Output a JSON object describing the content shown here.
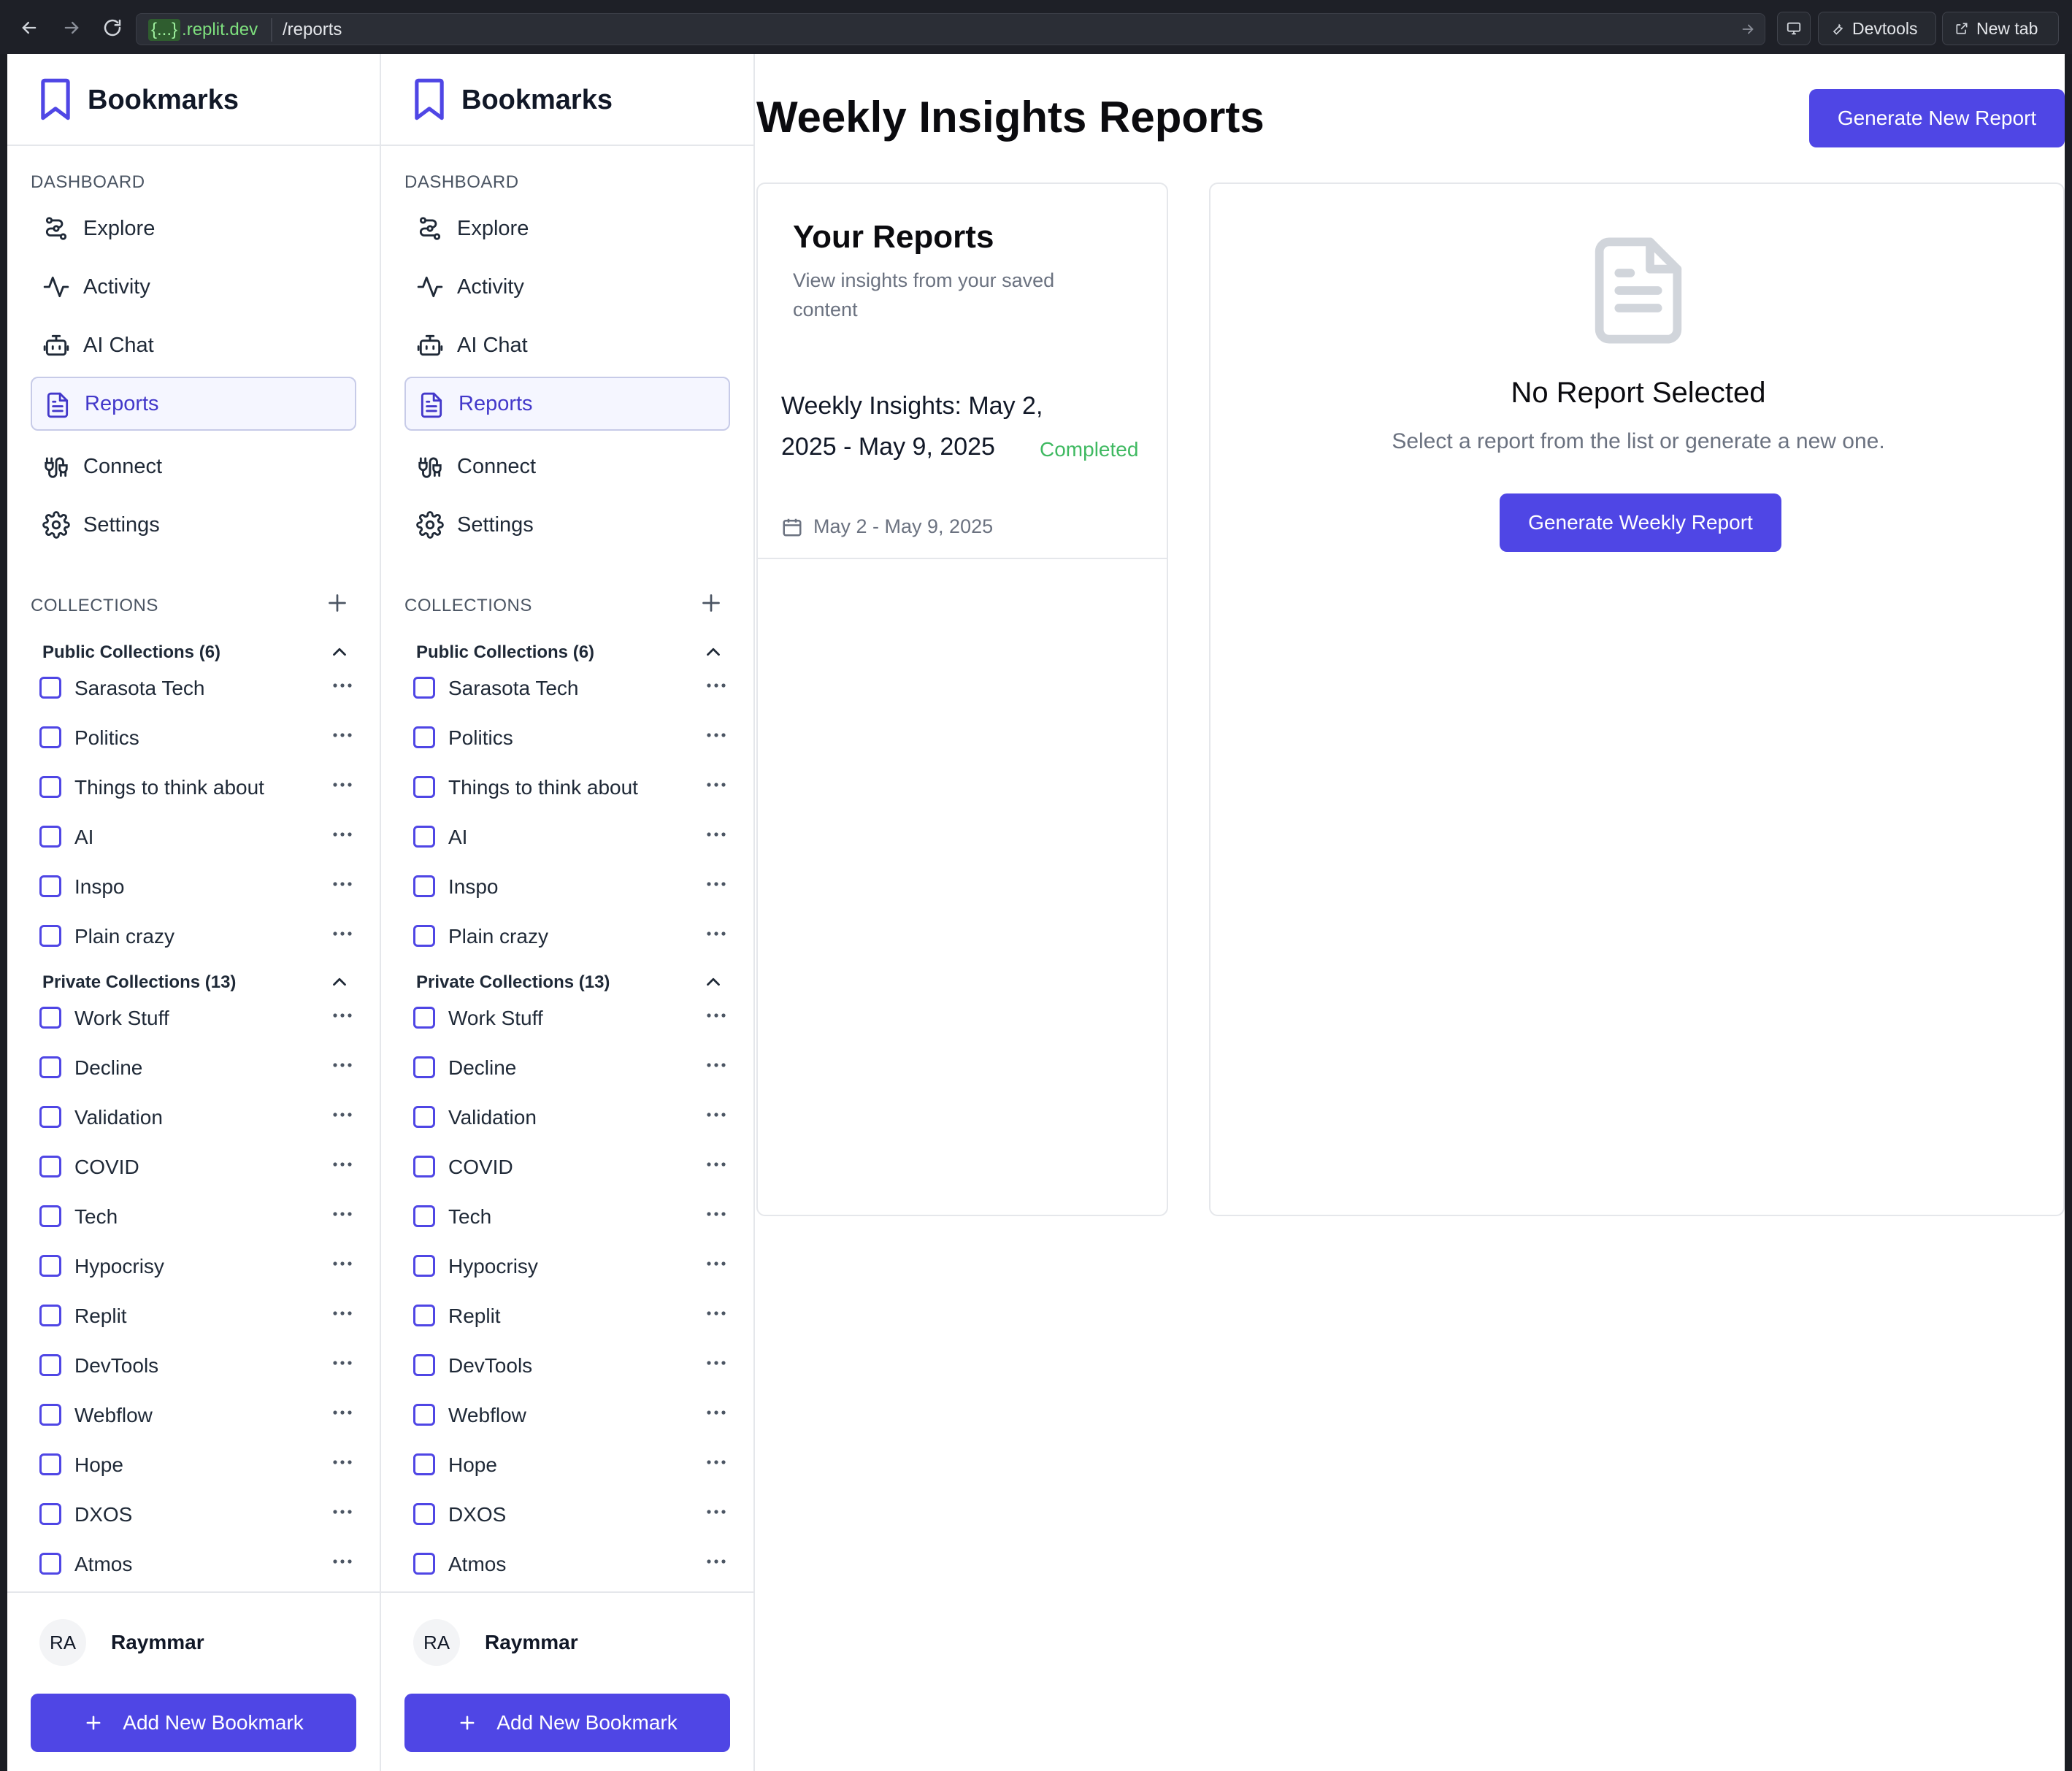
{
  "browser": {
    "url_host_braces": "{...}",
    "url_host": ".replit.dev",
    "url_path": "/reports",
    "devtools_label": "Devtools",
    "new_tab_label": "New tab"
  },
  "sidebar": {
    "title": "Bookmarks",
    "dashboard_label": "DASHBOARD",
    "nav": [
      {
        "label": "Explore",
        "icon": "explore-icon"
      },
      {
        "label": "Activity",
        "icon": "activity-icon"
      },
      {
        "label": "AI Chat",
        "icon": "bot-icon"
      },
      {
        "label": "Reports",
        "icon": "document-icon",
        "active": true
      },
      {
        "label": "Connect",
        "icon": "cable-icon"
      },
      {
        "label": "Settings",
        "icon": "gear-icon"
      }
    ],
    "collections_label": "COLLECTIONS",
    "public_group": "Public Collections (6)",
    "public_items": [
      "Sarasota Tech",
      "Politics",
      "Things to think about",
      "AI",
      "Inspo",
      "Plain crazy"
    ],
    "private_group": "Private Collections (13)",
    "private_items": [
      "Work Stuff",
      "Decline",
      "Validation",
      "COVID",
      "Tech",
      "Hypocrisy",
      "Replit",
      "DevTools",
      "Webflow",
      "Hope",
      "DXOS",
      "Atmos"
    ],
    "user_initials": "RA",
    "user_name": "Raymmar",
    "add_button": "Add New Bookmark"
  },
  "main": {
    "title": "Weekly Insights Reports",
    "generate_new": "Generate New Report",
    "list": {
      "title": "Your Reports",
      "subtitle": "View insights from your saved content",
      "reports": [
        {
          "title": "Weekly Insights: May 2, 2025 - May 9, 2025",
          "status": "Completed",
          "date": "May 2 - May 9, 2025"
        }
      ]
    },
    "detail": {
      "title": "No Report Selected",
      "subtitle": "Select a report from the list or generate a new one.",
      "button": "Generate Weekly Report"
    }
  },
  "colors": {
    "accent": "#4f46e5",
    "status_completed": "#3fb961"
  }
}
